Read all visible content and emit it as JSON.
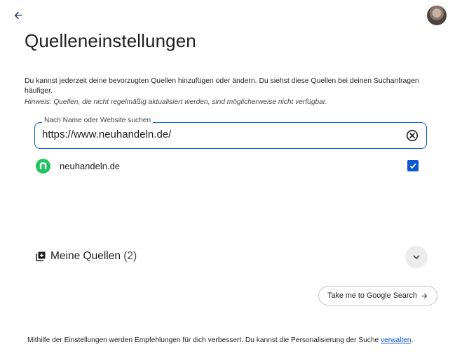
{
  "header": {
    "back_icon": "arrow-back-icon",
    "avatar_icon": "user-avatar"
  },
  "page": {
    "title": "Quelleneinstellungen",
    "intro": "Du kannst jederzeit deine bevorzugten Quellen hinzufügen oder ändern. Du siehst diese Quellen bei deinen Suchanfragen häufiger.",
    "hint": "Hinweis: Quellen, die nicht regelmäßig aktualisiert werden, sind möglicherweise nicht verfügbar."
  },
  "search": {
    "label": "Nach Name oder Website suchen",
    "value": "https://www.neuhandeln.de/",
    "clear_icon": "clear-circle-icon"
  },
  "results": [
    {
      "name": "neuhandeln.de",
      "logo_letter": "n",
      "logo_color": "#21c460",
      "checked": true
    }
  ],
  "my_sources": {
    "label": "Meine Quellen",
    "count": "(2)",
    "icon": "library-add-icon",
    "expand_icon": "chevron-down-icon"
  },
  "actions": {
    "google_search_label": "Take me to Google Search",
    "arrow_icon": "arrow-forward-icon"
  },
  "footer": {
    "text": "Mithilfe der Einstellungen werden Empfehlungen für dich verbessert. Du kannst die Personalisierung der Suche ",
    "link": "verwalten",
    "suffix": "."
  },
  "colors": {
    "accent": "#0b57d0",
    "site_logo": "#21c460"
  }
}
